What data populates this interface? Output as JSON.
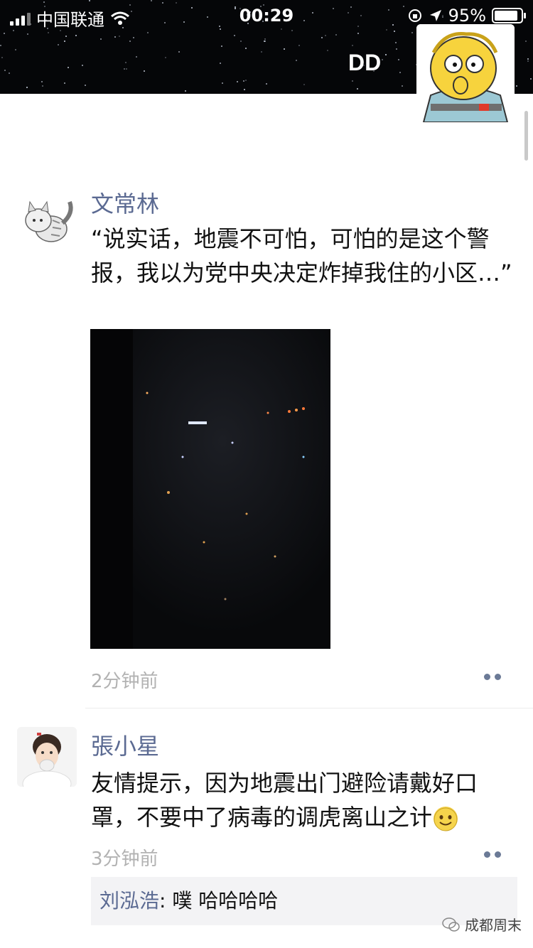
{
  "status_bar": {
    "carrier": "中国联通",
    "time": "00:29",
    "battery": "95%"
  },
  "profile": {
    "nickname": "DD"
  },
  "posts": [
    {
      "author": "文常林",
      "text": "“说实话，地震不可怕，可怕的是这个警报，我以为党中央决定炸掉我住的小区…”",
      "time": "2分钟前"
    },
    {
      "author": "張小星",
      "text": "友情提示，因为地震出门避险请戴好口罩，不要中了病毒的调虎离山之计",
      "time": "3分钟前",
      "comment_author": "刘泓浩",
      "comment_sep": ": ",
      "comment_text": "噗 哈哈哈哈"
    }
  ],
  "watermark": "成都周末"
}
